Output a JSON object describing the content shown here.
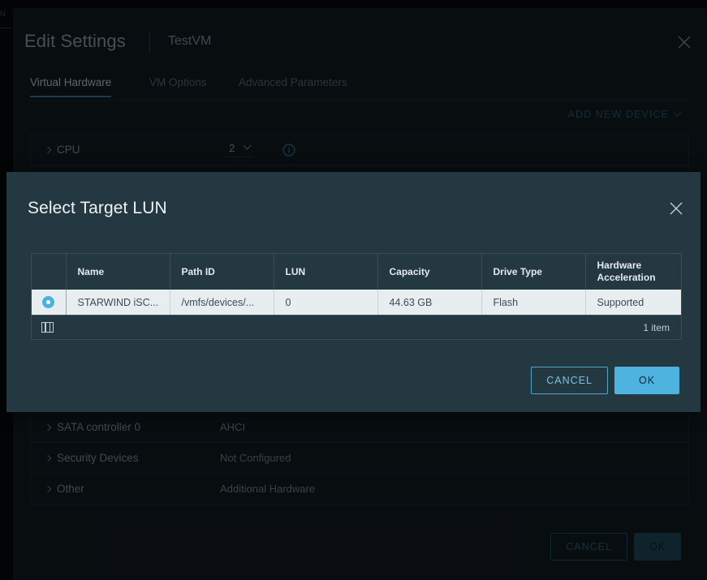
{
  "edge_bleed": "N",
  "edit_settings": {
    "title": "Edit Settings",
    "vm_name": "TestVM",
    "close_icon": "close-icon",
    "tabs": [
      {
        "label": "Virtual Hardware",
        "active": true
      },
      {
        "label": "VM Options",
        "active": false
      },
      {
        "label": "Advanced Parameters",
        "active": false
      }
    ],
    "add_new_device": {
      "label": "ADD NEW DEVICE",
      "caret_icon": "chevron-down-icon"
    },
    "devices": [
      {
        "name": "CPU",
        "value": "2",
        "control": "select",
        "caret_icon": "chevron-down-icon",
        "info_icon": "info-circle-icon",
        "expand_icon": "chevron-right-icon"
      },
      {
        "name": "SATA controller 0",
        "value": "AHCI",
        "control": "text",
        "expand_icon": "chevron-right-icon"
      },
      {
        "name": "Security Devices",
        "value": "Not Configured",
        "control": "text",
        "expand_icon": "chevron-right-icon"
      },
      {
        "name": "Other",
        "value": "Additional Hardware",
        "control": "text",
        "expand_icon": "chevron-right-icon"
      }
    ],
    "footer": {
      "cancel_label": "CANCEL",
      "ok_label": "OK"
    }
  },
  "modal": {
    "title": "Select Target LUN",
    "close_icon": "close-icon",
    "table": {
      "columns": [
        "",
        "Name",
        "Path ID",
        "LUN",
        "Capacity",
        "Drive Type",
        "Hardware Acceleration"
      ],
      "rows": [
        {
          "selected": true,
          "radio_icon": "radio-selected-icon",
          "name": "STARWIND iSC...",
          "path_id": "/vmfs/devices/...",
          "lun": "0",
          "capacity": "44.63 GB",
          "drive_type": "Flash",
          "hardware_acceleration": "Supported"
        }
      ],
      "footer": {
        "columns_icon": "column-layout-icon",
        "item_count": "1 item"
      }
    },
    "footer": {
      "cancel_label": "CANCEL",
      "ok_label": "OK"
    }
  },
  "colors": {
    "modal_bg": "#243841",
    "dialog_bg": "#0e1418",
    "accent_primary": "#4fb3df",
    "accent_link": "#1f5d72",
    "row_selected_bg": "#e8edf0",
    "tab_underline": "#3a7d95"
  }
}
